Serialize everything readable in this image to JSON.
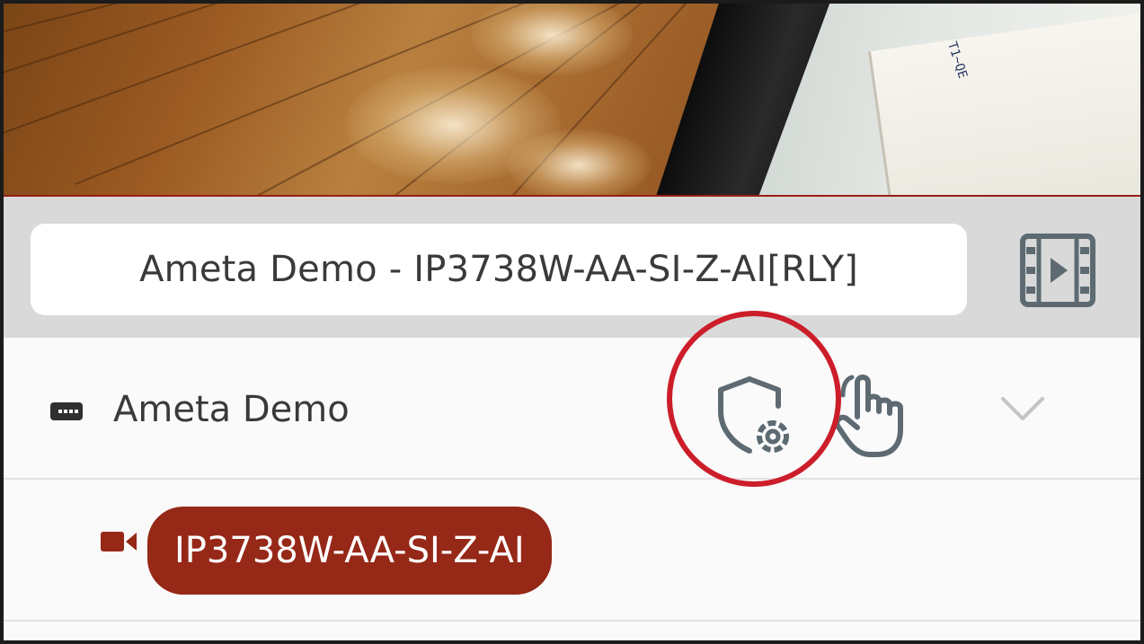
{
  "video": {
    "box_text": "T1~QE"
  },
  "header": {
    "title": "Ameta Demo - IP3738W-AA-SI-Z-AI[RLY]",
    "recordings_icon": "film-play-icon"
  },
  "device_group": {
    "label": "Ameta Demo",
    "icon": "nvr-device-icon",
    "actions": {
      "security_icon": "shield-gear-icon",
      "control_icon": "hand-pointer-icon",
      "expand_icon": "chevron-down-icon"
    }
  },
  "camera": {
    "label": "IP3738W-AA-SI-Z-AI",
    "icon": "camera-icon",
    "selected": true
  },
  "colors": {
    "accent": "#962818",
    "highlight_ring": "#cc1e2a",
    "header_bg": "#d9d9d9",
    "icon_gray": "#5d6a72"
  }
}
